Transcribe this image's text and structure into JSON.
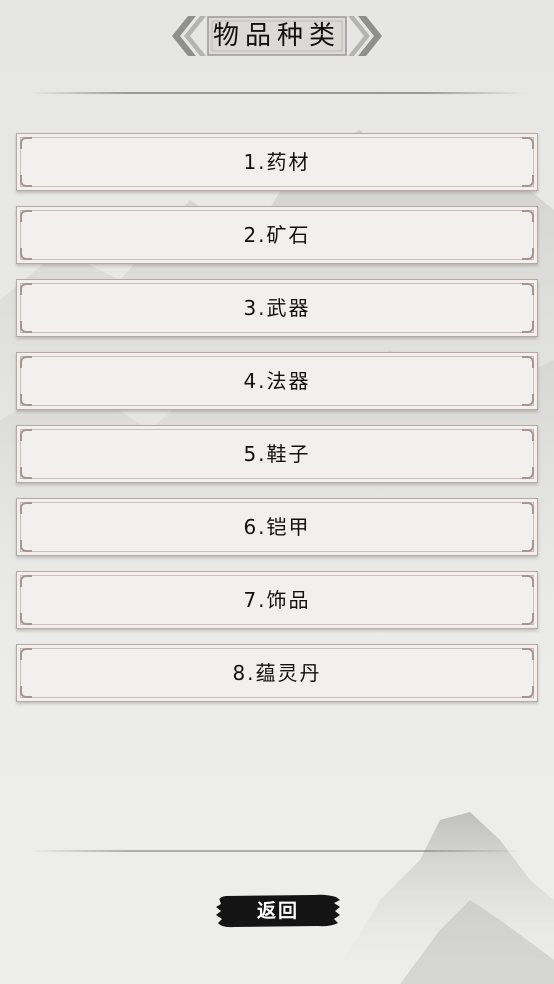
{
  "header": {
    "title": "物品种类"
  },
  "categories": [
    {
      "label": "1.药材"
    },
    {
      "label": "2.矿石"
    },
    {
      "label": "3.武器"
    },
    {
      "label": "4.法器"
    },
    {
      "label": "5.鞋子"
    },
    {
      "label": "6.铠甲"
    },
    {
      "label": "7.饰品"
    },
    {
      "label": "8.蕴灵丹"
    }
  ],
  "footer": {
    "back_label": "返回"
  },
  "colors": {
    "background": "#e8e8e6",
    "item_fill": "#f1f0ef",
    "item_border": "#b7aaa6",
    "button_ink": "#141414",
    "title_plate": "#d9d7d4"
  },
  "icons": [
    "double-chevron-left-ornament",
    "double-chevron-right-ornament",
    "ink-brush-stroke"
  ]
}
